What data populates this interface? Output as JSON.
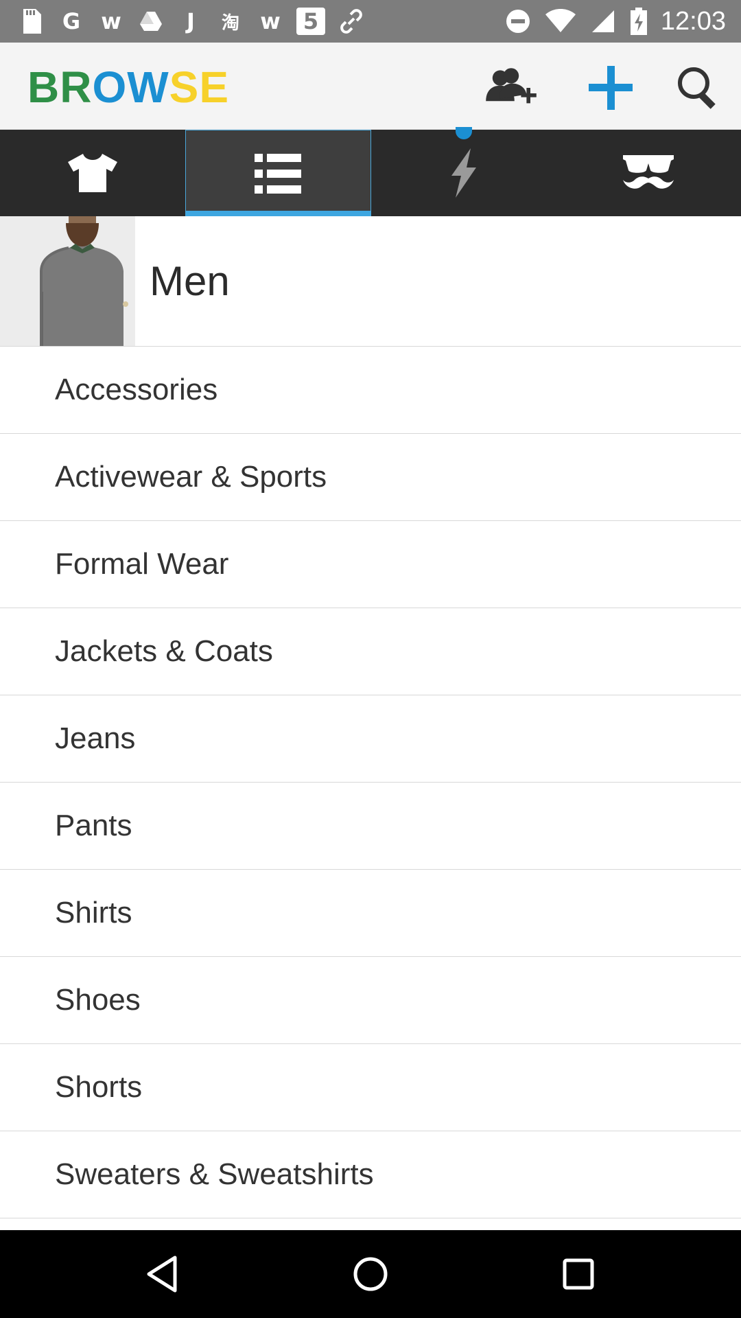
{
  "status_bar": {
    "time": "12:03",
    "notification_icons": [
      "sd-card-icon",
      "g-icon",
      "w-icon",
      "drive-icon",
      "j-icon",
      "taobao-icon",
      "w-icon",
      "html5-icon",
      "link-icon"
    ],
    "notification_glyphs": [
      "",
      "G",
      "w",
      "",
      "J",
      "淘",
      "w",
      "5",
      ""
    ],
    "system_icons": [
      "do-not-disturb-icon",
      "wifi-icon",
      "signal-icon",
      "battery-charging-icon"
    ]
  },
  "app_bar": {
    "brand": {
      "part1": "BR",
      "part2": "OW",
      "part3": "SE"
    },
    "actions": [
      "add-friend-icon",
      "add-icon",
      "search-icon"
    ]
  },
  "colors": {
    "brand_green": "#2f8f47",
    "brand_blue": "#1b8fd2",
    "brand_yellow": "#f7d12a",
    "accent": "#3ea6e0",
    "tab_bar_bg": "#2a2a2a",
    "status_bar_bg": "#7d7d7d"
  },
  "tabs": [
    {
      "icon": "tshirt-icon",
      "active": false
    },
    {
      "icon": "list-icon",
      "active": true
    },
    {
      "icon": "lightning-icon",
      "active": false,
      "badge": true
    },
    {
      "icon": "glasses-mustache-icon",
      "active": false
    }
  ],
  "header": {
    "title": "Men"
  },
  "categories": [
    "Accessories",
    "Activewear & Sports",
    "Formal Wear",
    "Jackets & Coats",
    "Jeans",
    "Pants",
    "Shirts",
    "Shoes",
    "Shorts",
    "Sweaters & Sweatshirts"
  ],
  "nav_bar": {
    "buttons": [
      "back-icon",
      "home-icon",
      "recents-icon"
    ]
  }
}
